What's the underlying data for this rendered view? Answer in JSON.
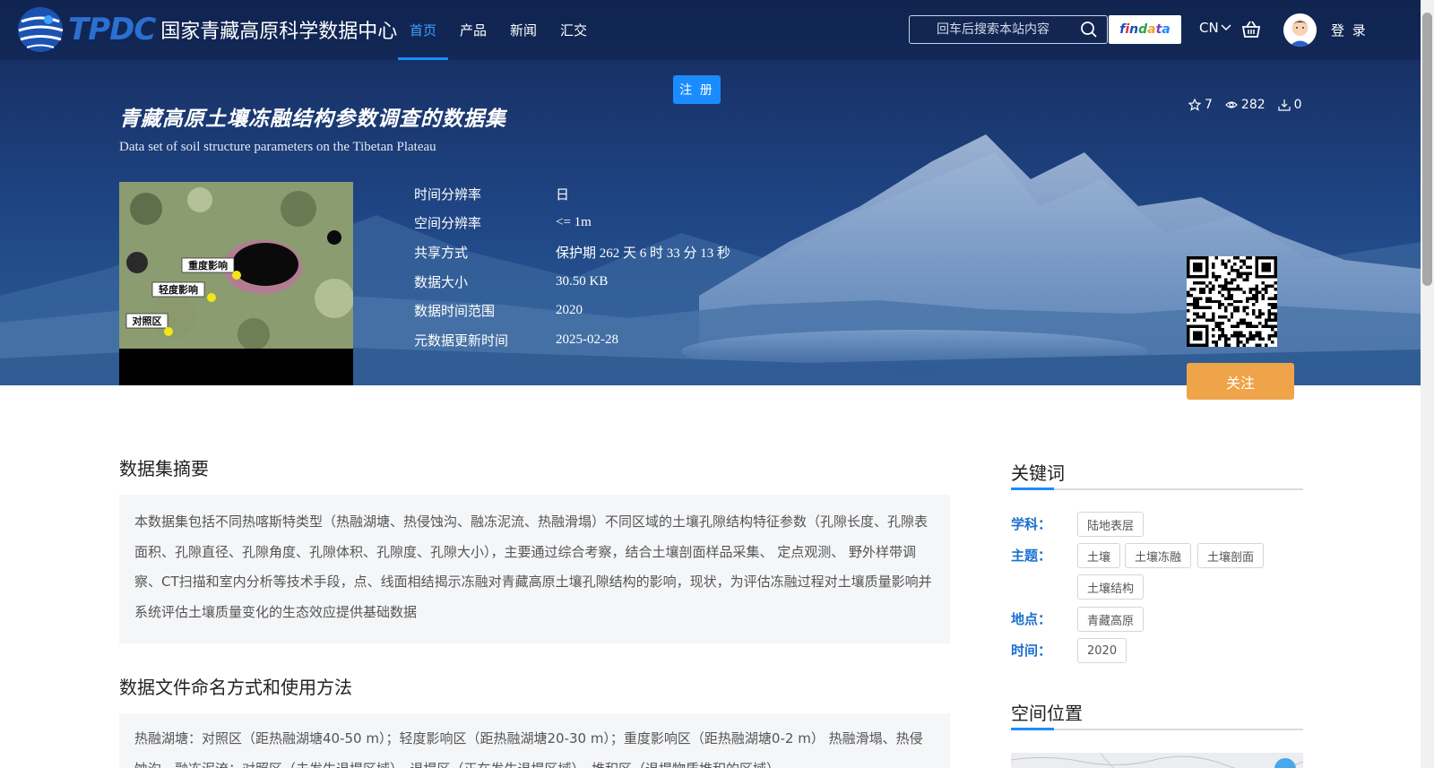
{
  "header": {
    "logo_abbr": "TPDC",
    "site_name": "国家青藏高原科学数据中心",
    "nav": [
      {
        "label": "首页",
        "active": true
      },
      {
        "label": "产品",
        "active": false
      },
      {
        "label": "新闻",
        "active": false
      },
      {
        "label": "汇交",
        "active": false
      }
    ],
    "search_placeholder": "回车后搜索本站内容",
    "findata_label": "findata",
    "lang": "CN",
    "login_label": "登 录",
    "register_label": "注 册"
  },
  "dataset": {
    "title": "青藏高原土壤冻融结构参数调查的数据集",
    "subtitle": "Data set of soil structure parameters on the Tibetan Plateau",
    "stats": {
      "stars": "7",
      "views": "282",
      "downloads": "0"
    },
    "thumbnail_labels": [
      "重度影响",
      "轻度影响",
      "对照区"
    ],
    "meta": [
      {
        "label": "时间分辨率",
        "value": "日"
      },
      {
        "label": "空间分辨率",
        "value": "<= 1m"
      },
      {
        "label": "共享方式",
        "value": "保护期 262 天 6 时 33 分 13 秒"
      },
      {
        "label": "数据大小",
        "value": "30.50 KB"
      },
      {
        "label": "数据时间范围",
        "value": "2020"
      },
      {
        "label": "元数据更新时间",
        "value": "2025-02-28"
      }
    ],
    "follow_label": "关注"
  },
  "main": {
    "abstract_title": "数据集摘要",
    "abstract_text": "本数据集包括不同热喀斯特类型（热融湖塘、热侵蚀沟、融冻泥流、热融滑塌）不同区域的土壤孔隙结构特征参数（孔隙长度、孔隙表面积、孔隙直径、孔隙角度、孔隙体积、孔隙度、孔隙大小），主要通过综合考察，结合土壤剖面样品采集、 定点观测、 野外样带调察、CT扫描和室内分析等技术手段，点、线面相结揭示冻融对青藏高原土壤孔隙结构的影响，现状，为评估冻融过程对土壤质量影响并系统评估土壤质量变化的生态效应提供基础数据",
    "naming_title": "数据文件命名方式和使用方法",
    "naming_text": "热融湖塘：对照区（距热融湖塘40-50 m）；轻度影响区（距热融湖塘20-30 m）；重度影响区（距热融湖塘0-2 m） 热融滑塌、热侵蚀沟、融冻泥流：对照区（未发生退塌区域）、退塌区（正在发生退塌区域）、堆积区（退塌物质堆积的区域）"
  },
  "sidebar": {
    "keywords_title": "关键词",
    "groups": [
      {
        "label": "学科：",
        "tags": [
          "陆地表层"
        ]
      },
      {
        "label": "主题：",
        "tags": [
          "土壤",
          "土壤冻融",
          "土壤剖面",
          "土壤结构"
        ]
      },
      {
        "label": "地点：",
        "tags": [
          "青藏高原"
        ]
      },
      {
        "label": "时间：",
        "tags": [
          "2020"
        ]
      }
    ],
    "location_title": "空间位置"
  },
  "colors": {
    "accent": "#1a8cff",
    "follow": "#f0a44a",
    "keyword_label": "#1a6fd1"
  }
}
